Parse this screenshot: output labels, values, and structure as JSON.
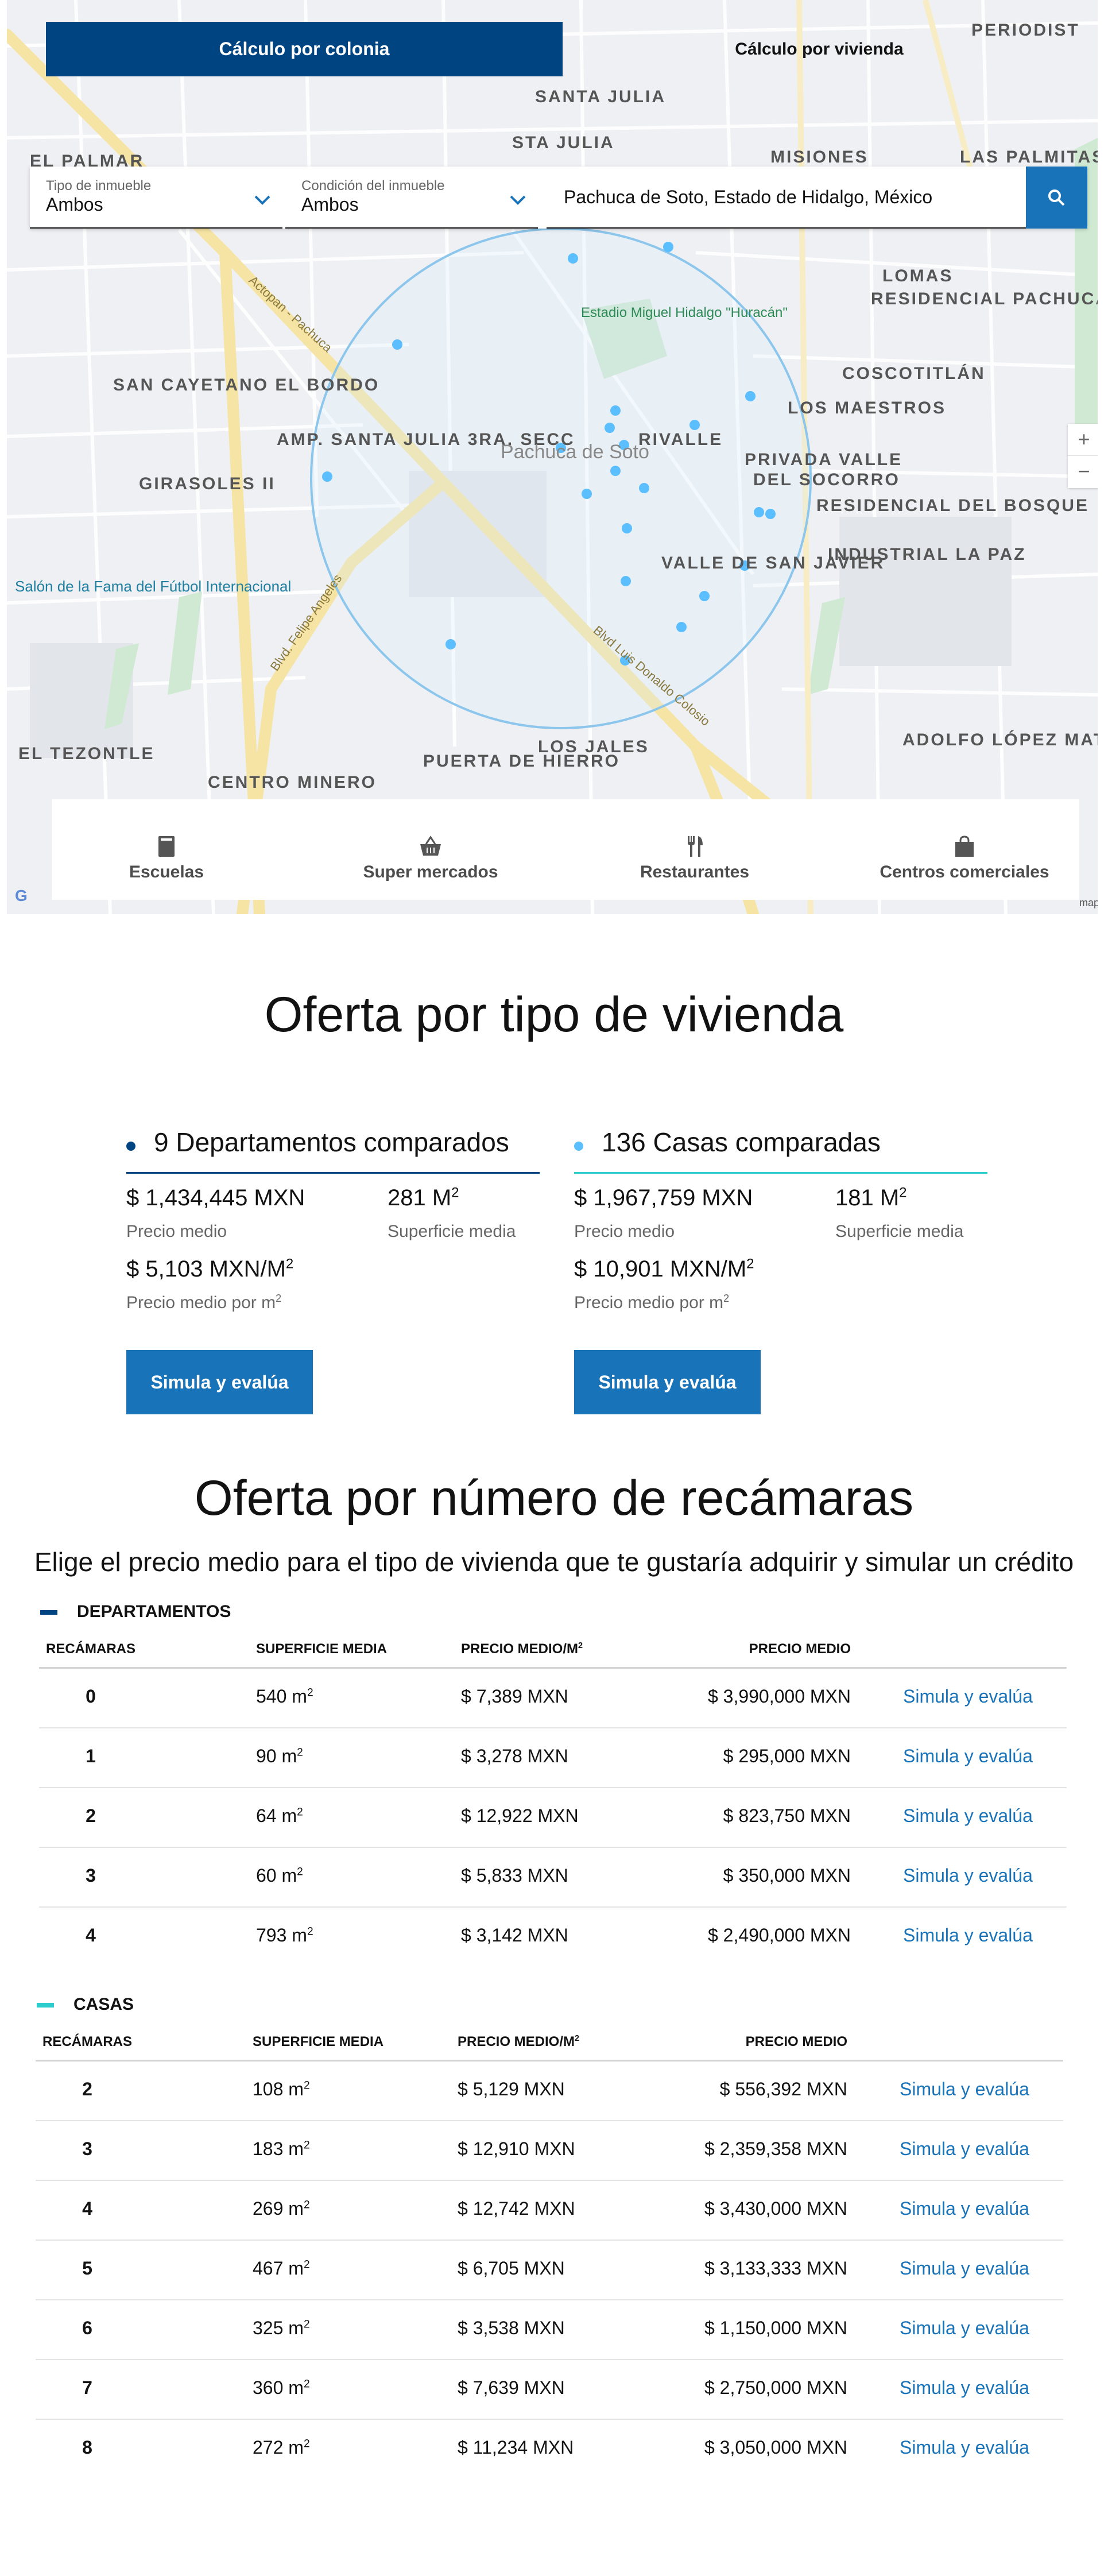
{
  "map": {
    "tabs": {
      "colonia": "Cálculo por colonia",
      "vivienda": "Cálculo por vivienda"
    },
    "filters": {
      "tipo": {
        "label": "Tipo de inmueble",
        "value": "Ambos"
      },
      "condicion": {
        "label": "Condición del inmueble",
        "value": "Ambos"
      }
    },
    "search": {
      "value": "Pachuca de Soto, Estado de Hidalgo, México"
    },
    "zoom": {
      "in": "+",
      "out": "−"
    },
    "labels": {
      "santa_julia": "SANTA JULIA",
      "sta_julia": "STA JULIA",
      "el_palmar": "EL PALMAR",
      "misiones": "MISIONES",
      "las_palmitas": "LAS PALMITAS",
      "periodista": "PERIODIST",
      "lomas": "LOMAS",
      "residencial_pachuca": "RESIDENCIAL PACHUCA",
      "coscotitlan": "COSCOTITLÁN",
      "los_maestros": "LOS MAESTROS",
      "rivalle": "RIVALLE",
      "privada_valle": "PRIVADA VALLE",
      "del_socorro": "DEL SOCORRO",
      "residencial_bosque": "RESIDENCIAL DEL BOSQUE",
      "industrial_paz": "INDUSTRIAL LA PAZ",
      "valle_san_javier": "VALLE DE SAN JAVIER",
      "san_cayetano": "SAN CAYETANO EL BORDO",
      "amp_santa_julia": "AMP. SANTA JULIA 3RA. SECC",
      "girasoles": "GIRASOLES II",
      "pachuca": "Pachuca de Soto",
      "estadio": "Estadio Miguel Hidalgo \"Huracán\"",
      "salon_fama": "Salón de la Fama del Fútbol Internacional",
      "el_tezontle": "EL TEZONTLE",
      "centro_minero": "CENTRO MINERO",
      "puerta_hierro": "PUERTA DE HIERRO",
      "los_jales": "LOS JALES",
      "adolfo_lopez": "ADOLFO LÓPEZ MATEOS",
      "actopan": "Actopan - Pachuca",
      "felipe_angeles": "Blvd. Felipe Angeles",
      "colosio": "Blvd Luis Donaldo Colosio",
      "mapa": "mapa"
    },
    "amenities": [
      {
        "label": "Escuelas",
        "icon": "book-icon"
      },
      {
        "label": "Super mercados",
        "icon": "basket-icon"
      },
      {
        "label": "Restaurantes",
        "icon": "fork-knife-icon"
      },
      {
        "label": "Centros comerciales",
        "icon": "shopping-bag-icon"
      }
    ]
  },
  "oferta_tipo": {
    "title": "Oferta por tipo de vivienda",
    "departamentos": {
      "title": "9 Departamentos comparados",
      "precio_medio": "$ 1,434,445 MXN",
      "precio_medio_label": "Precio medio",
      "superficie": "281 M",
      "superficie_label": "Superficie media",
      "precio_m2": "$ 5,103 MXN/M",
      "precio_m2_label": "Precio medio por m",
      "button": "Simula y evalúa"
    },
    "casas": {
      "title": "136 Casas comparadas",
      "precio_medio": "$ 1,967,759 MXN",
      "precio_medio_label": "Precio medio",
      "superficie": "181 M",
      "superficie_label": "Superficie media",
      "precio_m2": "$ 10,901 MXN/M",
      "precio_m2_label": "Precio medio por m",
      "button": "Simula y evalúa"
    }
  },
  "oferta_recamaras": {
    "title": "Oferta por número de recámaras",
    "subtitle": "Elige el precio medio para el tipo de vivienda que te gustaría adquirir y simular un crédito",
    "headers": {
      "recamaras": "RECÁMARAS",
      "superficie": "SUPERFICIE MEDIA",
      "precio_m2": "PRECIO MEDIO/M",
      "precio": "PRECIO MEDIO"
    },
    "link_label": "Simula y evalúa",
    "departamentos": {
      "name": "DEPARTAMENTOS",
      "rows": [
        {
          "rec": "0",
          "sup": "540 m",
          "ppm": "$ 7,389 MXN",
          "pm": "$ 3,990,000 MXN"
        },
        {
          "rec": "1",
          "sup": "90 m",
          "ppm": "$ 3,278 MXN",
          "pm": "$ 295,000 MXN"
        },
        {
          "rec": "2",
          "sup": "64 m",
          "ppm": "$ 12,922 MXN",
          "pm": "$ 823,750 MXN"
        },
        {
          "rec": "3",
          "sup": "60 m",
          "ppm": "$ 5,833 MXN",
          "pm": "$ 350,000 MXN"
        },
        {
          "rec": "4",
          "sup": "793 m",
          "ppm": "$ 3,142 MXN",
          "pm": "$ 2,490,000 MXN"
        }
      ]
    },
    "casas": {
      "name": "CASAS",
      "rows": [
        {
          "rec": "2",
          "sup": "108 m",
          "ppm": "$ 5,129 MXN",
          "pm": "$ 556,392 MXN"
        },
        {
          "rec": "3",
          "sup": "183 m",
          "ppm": "$ 12,910 MXN",
          "pm": "$ 2,359,358 MXN"
        },
        {
          "rec": "4",
          "sup": "269 m",
          "ppm": "$ 12,742 MXN",
          "pm": "$ 3,430,000 MXN"
        },
        {
          "rec": "5",
          "sup": "467 m",
          "ppm": "$ 6,705 MXN",
          "pm": "$ 3,133,333 MXN"
        },
        {
          "rec": "6",
          "sup": "325 m",
          "ppm": "$ 3,538 MXN",
          "pm": "$ 1,150,000 MXN"
        },
        {
          "rec": "7",
          "sup": "360 m",
          "ppm": "$ 7,639 MXN",
          "pm": "$ 2,750,000 MXN"
        },
        {
          "rec": "8",
          "sup": "272 m",
          "ppm": "$ 11,234 MXN",
          "pm": "$ 3,050,000 MXN"
        }
      ]
    }
  },
  "colors": {
    "primary": "#004481",
    "accent": "#1973b8",
    "aqua": "#2dcccd",
    "marker": "#5bbeff"
  }
}
